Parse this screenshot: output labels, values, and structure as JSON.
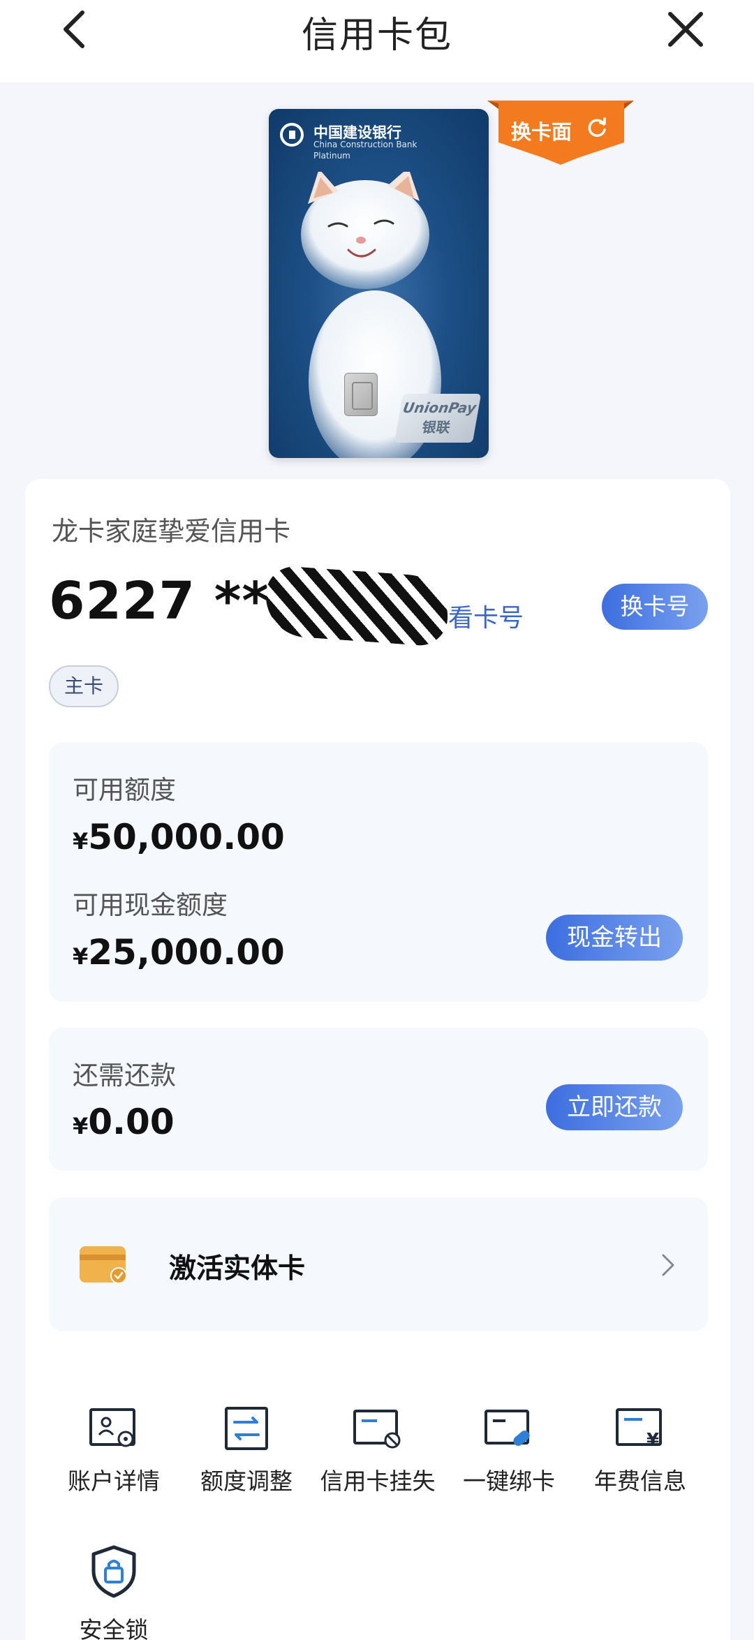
{
  "header": {
    "title": "信用卡包"
  },
  "card_image": {
    "bank_name": "中国建设银行",
    "bank_name_en": "China Construction Bank",
    "tier": "Platinum",
    "network_en": "UnionPay",
    "network_cn": "银联",
    "change_face_label": "换卡面"
  },
  "card_info": {
    "name": "龙卡家庭挚爱信用卡",
    "number_prefix": "6227 **",
    "view_number_label": "看卡号",
    "change_number_label": "换卡号",
    "main_card_badge": "主卡"
  },
  "credit": {
    "available_label": "可用额度",
    "currency": "¥",
    "available_amount": "50,000.00",
    "cash_label": "可用现金额度",
    "cash_amount": "25,000.00",
    "cash_out_button": "现金转出"
  },
  "repay": {
    "label": "还需还款",
    "amount": "0.00",
    "button": "立即还款"
  },
  "activate": {
    "label": "激活实体卡"
  },
  "quick_actions": [
    {
      "label": "账户详情",
      "icon": "account-details-icon"
    },
    {
      "label": "额度调整",
      "icon": "limit-adjust-icon"
    },
    {
      "label": "信用卡挂失",
      "icon": "report-loss-icon"
    },
    {
      "label": "一键绑卡",
      "icon": "bind-card-icon"
    },
    {
      "label": "年费信息",
      "icon": "annual-fee-icon"
    },
    {
      "label": "安全锁",
      "icon": "security-lock-icon"
    }
  ],
  "colors": {
    "accent": "#3d6ee0",
    "orange": "#f47a1f",
    "icon_dark": "#1f2937",
    "icon_blue": "#2f7fd6"
  }
}
